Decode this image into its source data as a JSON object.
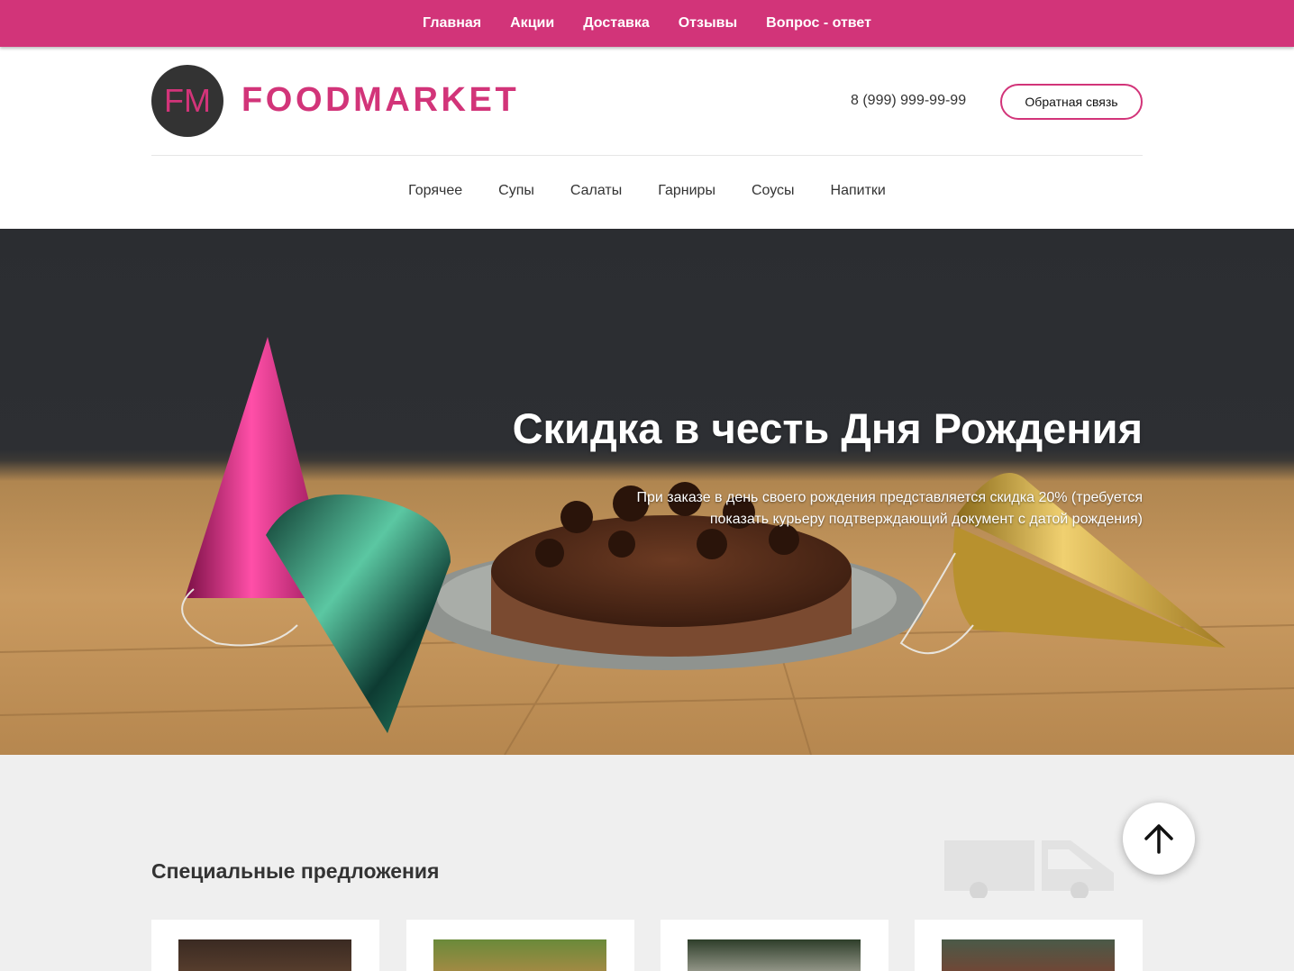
{
  "top_nav": [
    "Главная",
    "Акции",
    "Доставка",
    "Отзывы",
    "Вопрос - ответ"
  ],
  "header": {
    "logo_text": "FM",
    "brand": "FOODMARKET",
    "phone": "8 (999) 999-99-99",
    "feedback_label": "Обратная связь"
  },
  "categories": [
    "Горячее",
    "Супы",
    "Салаты",
    "Гарниры",
    "Соусы",
    "Напитки"
  ],
  "hero": {
    "title": "Скидка в честь Дня Рождения",
    "text": "При заказе в день своего рождения представляется скидка 20% (требуется показать курьеру подтверждающий документ с датой рождения)"
  },
  "special": {
    "title": "Специальные предложения"
  },
  "colors": {
    "accent": "#d23479",
    "dark": "#333333",
    "page_bg": "#efefef"
  },
  "icons": {
    "scroll_top": "arrow-up-icon",
    "truck": "truck-icon"
  }
}
